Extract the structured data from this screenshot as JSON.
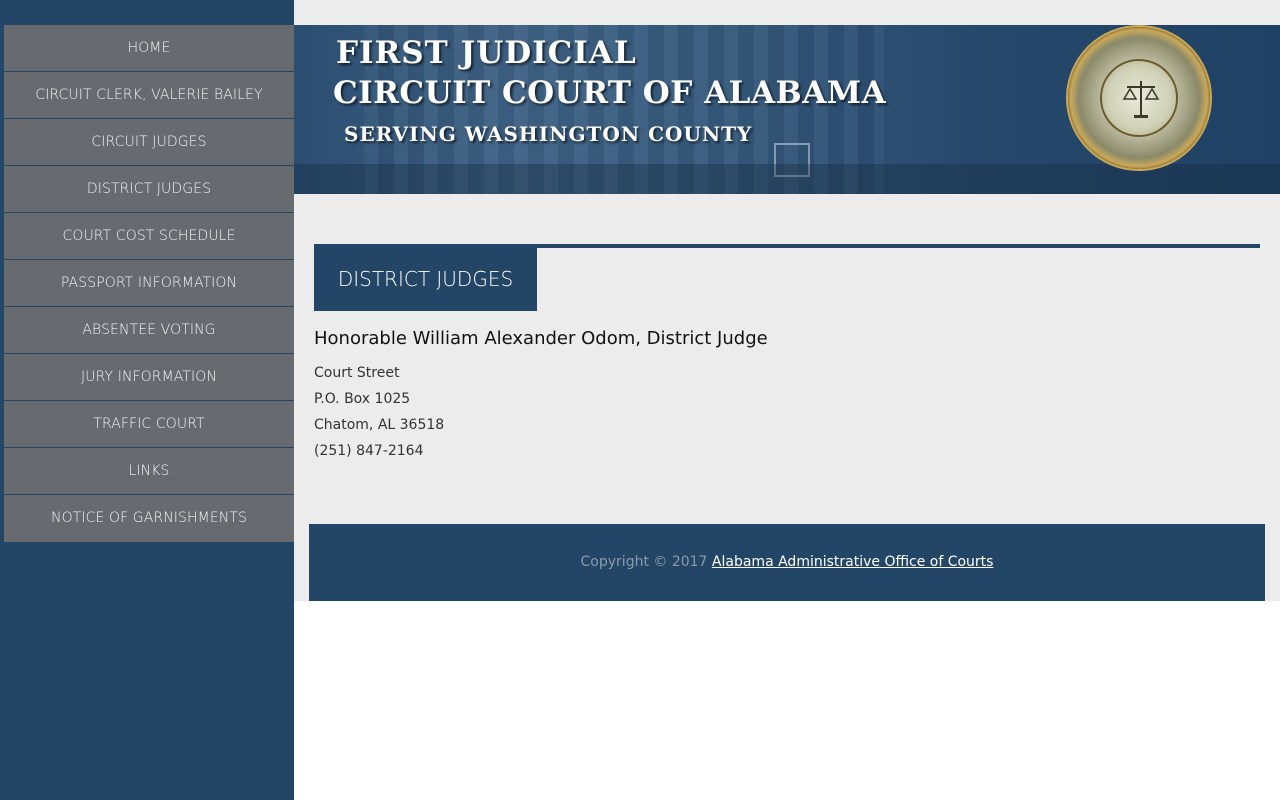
{
  "nav": {
    "items": [
      {
        "label": "HOME"
      },
      {
        "label": "CIRCUIT CLERK, VALERIE BAILEY"
      },
      {
        "label": "CIRCUIT JUDGES"
      },
      {
        "label": "DISTRICT JUDGES"
      },
      {
        "label": "COURT COST SCHEDULE"
      },
      {
        "label": "PASSPORT INFORMATION"
      },
      {
        "label": "ABSENTEE VOTING"
      },
      {
        "label": "JURY INFORMATION"
      },
      {
        "label": "TRAFFIC COURT"
      },
      {
        "label": "LINKS"
      },
      {
        "label": "NOTICE OF GARNISHMENTS"
      }
    ]
  },
  "banner": {
    "line1": "FIRST JUDICIAL",
    "line2": "CIRCUIT COURT OF ALABAMA",
    "line3": "SERVING WASHINGTON COUNTY",
    "seal_icon": "unified-judicial-system-seal-icon"
  },
  "section": {
    "tab_label": "DISTRICT JUDGES"
  },
  "judge": {
    "name": "Honorable William Alexander Odom, District Judge",
    "address": [
      "Court Street",
      "P.O. Box 1025",
      "Chatom, AL 36518",
      "(251) 847-2164"
    ]
  },
  "footer": {
    "copyright": "Copyright © 2017 ",
    "link_label": "Alabama Administrative Office of Courts"
  },
  "colors": {
    "brand_navy": "#234666",
    "nav_gray": "#676b6f",
    "content_bg": "#ececec"
  }
}
